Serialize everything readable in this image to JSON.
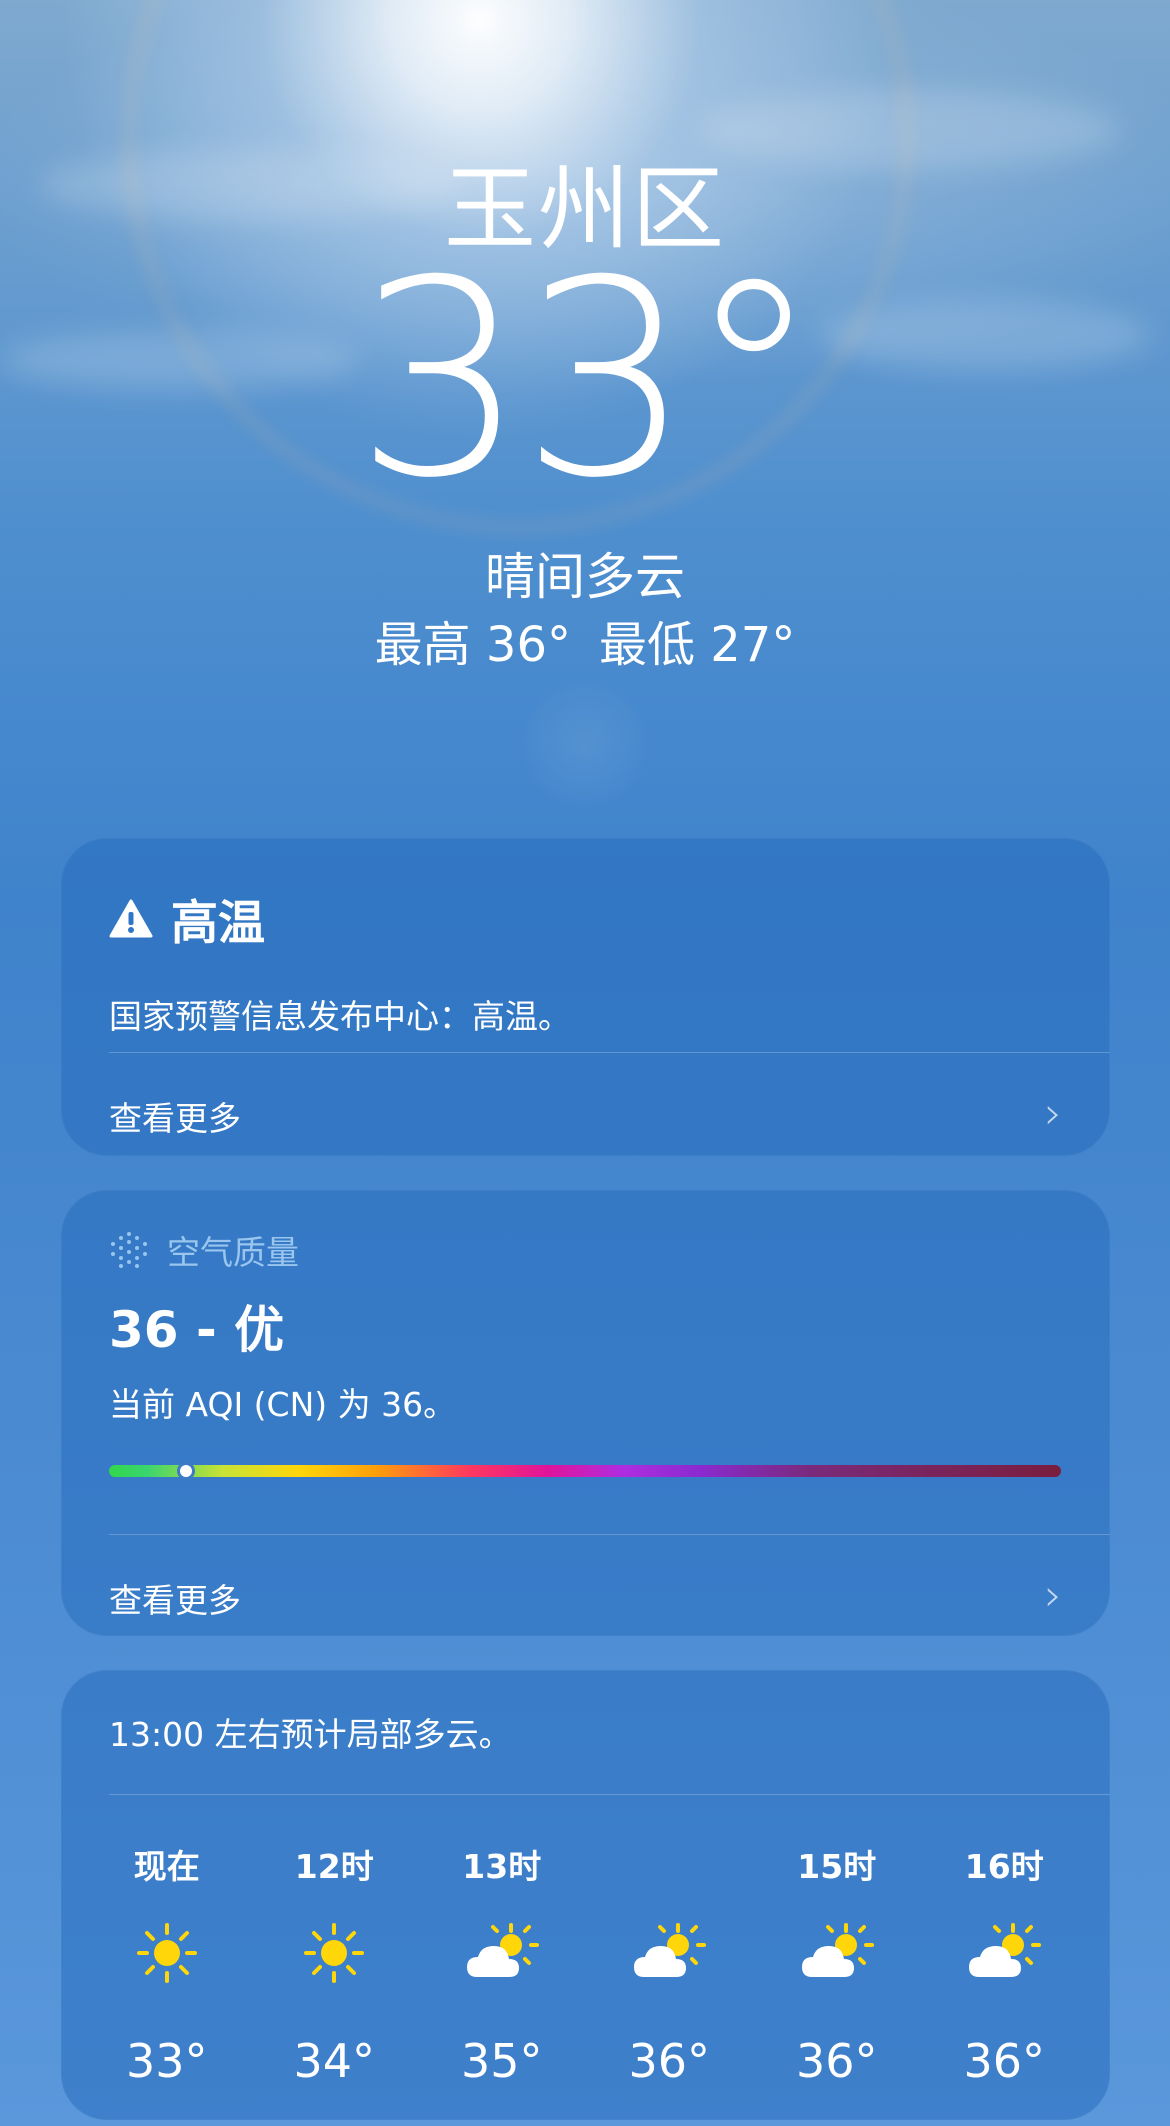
{
  "location": "玉州区",
  "current_temp": "33°",
  "condition": "晴间多云",
  "high": "最高 36°",
  "low": "最低 27°",
  "alert_card": {
    "title": "高温",
    "icon": "warning-icon",
    "body": "国家预警信息发布中心：高温。",
    "more_label": "查看更多"
  },
  "air_quality": {
    "header": "空气质量",
    "icon": "air-quality-icon",
    "value": "36 - 优",
    "description": "当前 AQI (CN) 为 36。",
    "indicator_position": 0.08,
    "more_label": "查看更多"
  },
  "forecast": {
    "summary": "13:00 左右预计局部多云。",
    "hours": [
      {
        "label": "现在",
        "icon": "sun-icon",
        "temp": "33°"
      },
      {
        "label": "12时",
        "icon": "sun-icon",
        "temp": "34°"
      },
      {
        "label": "13时",
        "icon": "partly-cloudy-icon",
        "temp": "35°"
      },
      {
        "label": "",
        "icon": "partly-cloudy-icon",
        "temp": "36°"
      },
      {
        "label": "15时",
        "icon": "partly-cloudy-icon",
        "temp": "36°"
      },
      {
        "label": "16时",
        "icon": "partly-cloudy-icon",
        "temp": "36°"
      }
    ]
  }
}
